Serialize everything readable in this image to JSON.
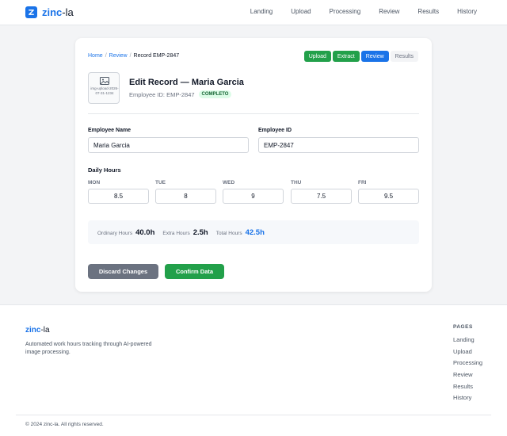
{
  "brand": {
    "name": "zinc",
    "suffix": "-la"
  },
  "nav": {
    "links": [
      "Landing",
      "Upload",
      "Processing",
      "Review",
      "Results",
      "History"
    ]
  },
  "breadcrumb": {
    "home": "Home",
    "review": "Review",
    "current": "Record EMP-2847"
  },
  "steps": {
    "upload": "Upload",
    "extract": "Extract",
    "review": "Review",
    "results": "Results"
  },
  "thumbnail": {
    "text": "img-upload-2026-07-31-1234"
  },
  "record": {
    "title": "Edit Record — Maria Garcia",
    "employee_id_text": "Employee ID: EMP-2847",
    "status": "COMPLETO"
  },
  "form": {
    "name_label": "Employee Name",
    "name_value": "Maria Garcia",
    "id_label": "Employee ID",
    "id_value": "EMP-2847"
  },
  "hours": {
    "section_label": "Daily Hours",
    "days": [
      {
        "label": "MON",
        "value": "8.5"
      },
      {
        "label": "TUE",
        "value": "8"
      },
      {
        "label": "WED",
        "value": "9"
      },
      {
        "label": "THU",
        "value": "7.5"
      },
      {
        "label": "FRI",
        "value": "9.5"
      }
    ]
  },
  "summary": {
    "ordinary_label": "Ordinary Hours",
    "ordinary_value": "40.0h",
    "extra_label": "Extra Hours",
    "extra_value": "2.5h",
    "total_label": "Total Hours",
    "total_value": "42.5h"
  },
  "actions": {
    "discard": "Discard Changes",
    "confirm": "Confirm Data"
  },
  "footer": {
    "brand_name": "zinc",
    "brand_suffix": "-la",
    "description": "Automated work hours tracking through AI-powered image processing.",
    "pages_title": "PAGES",
    "links": [
      "Landing",
      "Upload",
      "Processing",
      "Review",
      "Results",
      "History"
    ],
    "copyright": "© 2024 zinc-la. All rights reserved."
  },
  "colors": {
    "accent": "#1a73e8",
    "success": "#22a04a",
    "neutral_button": "#6b7280",
    "badge_bg": "#dcfce7"
  }
}
